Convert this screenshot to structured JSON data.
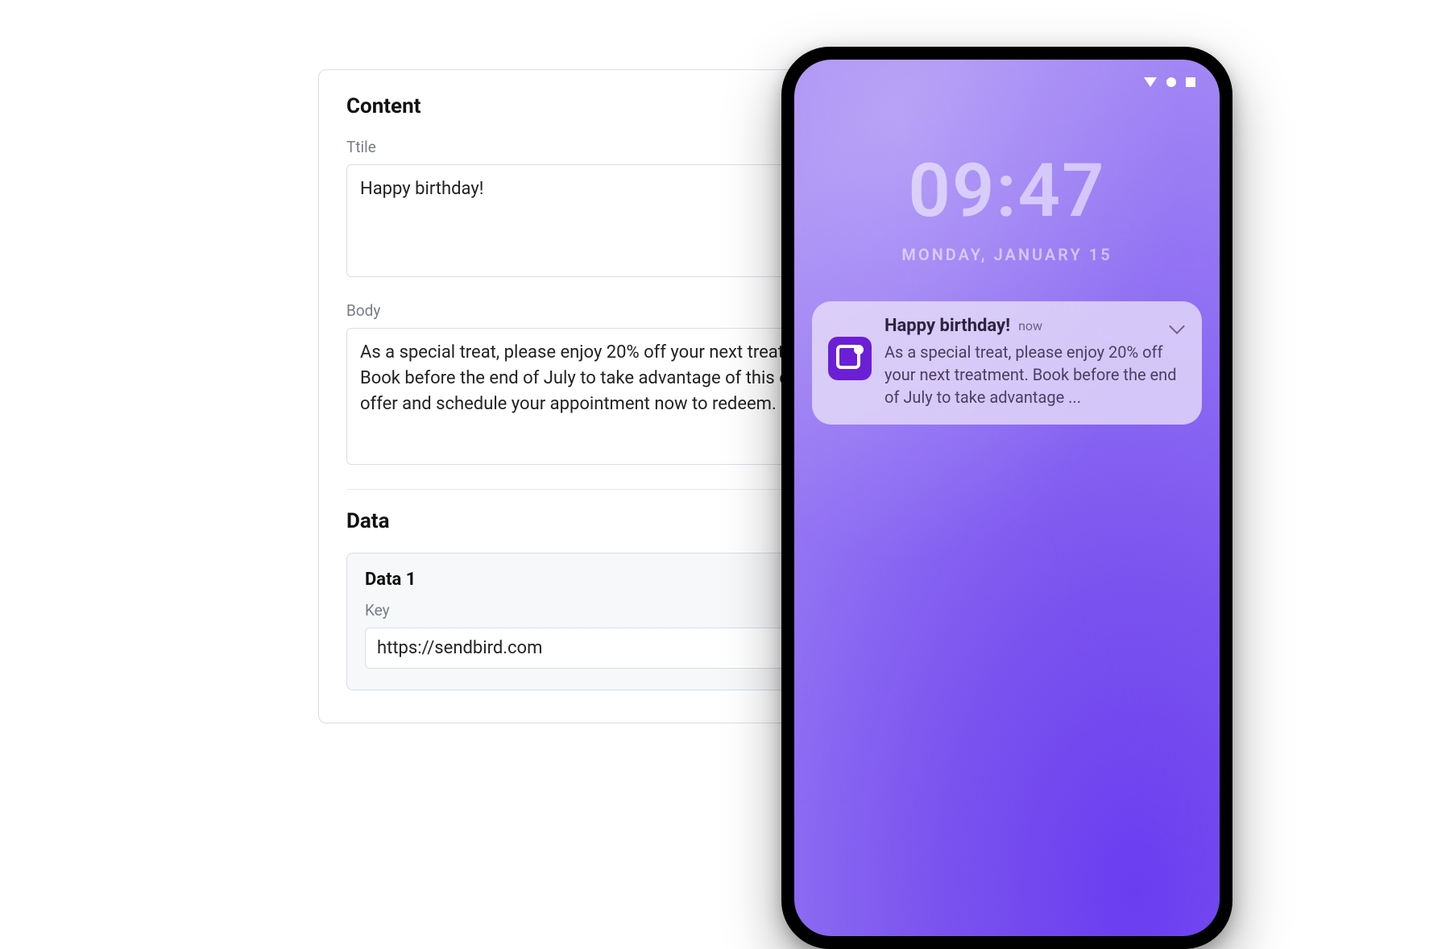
{
  "form": {
    "content_heading": "Content",
    "title_label": "Ttile",
    "title_value": "Happy birthday!",
    "body_label": "Body",
    "body_value": "As a special treat, please enjoy 20% off your next treatment. Book before the end of July to take advantage of this exclusive offer and schedule your appointment now to redeem.",
    "data_heading": "Data",
    "data_card_title": "Data 1",
    "key_label": "Key",
    "key_value": "https://sendbird.com"
  },
  "phone": {
    "time": "09:47",
    "date": "MONDAY, JANUARY 15",
    "status_icons": [
      "triangle-down-icon",
      "circle-icon",
      "square-icon"
    ],
    "notification": {
      "app_icon": "app-icon",
      "title": "Happy birthday!",
      "timestamp": "now",
      "body": "As a special treat, please enjoy 20% off your next treatment. Book before the end of July to take advantage ..."
    }
  },
  "colors": {
    "accent_purple": "#6b1fd6",
    "screen_gradient_top": "#a58af5",
    "screen_gradient_bottom": "#6a3df0"
  }
}
